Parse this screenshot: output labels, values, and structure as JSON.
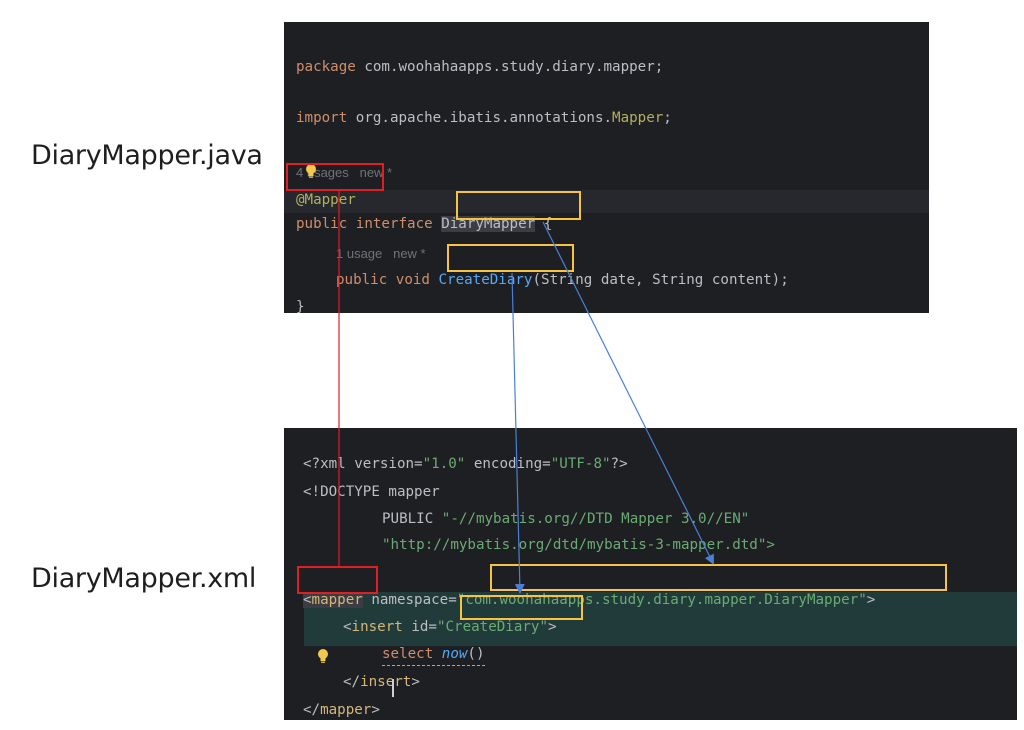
{
  "labels": {
    "java_file": "DiaryMapper.java",
    "xml_file": "DiaryMapper.xml"
  },
  "java_editor": {
    "line1": {
      "kw": "package",
      "rest": " com.woohahaapps.study.diary.mapper;"
    },
    "line2": {
      "kw": "import",
      "rest": " org.apache.ibatis.annotations.",
      "ann": "Mapper",
      "end": ";"
    },
    "usages_hint": "4 usages   new *",
    "line3": {
      "text": "@Mapper"
    },
    "line4": {
      "kw": "public interface",
      "name": "DiaryMapper",
      "end": " {"
    },
    "method_hint": "1 usage   new *",
    "line5": {
      "kw": "public void",
      "name": "CreateDiary",
      "params": "(String date, String content);"
    },
    "line6": "}"
  },
  "xml_editor": {
    "line1": {
      "a": "<?",
      "b": "xml version=",
      "c": "\"1.0\"",
      "d": " encoding=",
      "e": "\"UTF-8\"",
      "f": "?>"
    },
    "line2": {
      "a": "<!DOCTYPE ",
      "b": "mapper"
    },
    "line3": {
      "a": "PUBLIC ",
      "b": "\"-//mybatis.org//DTD Mapper 3.0//EN\""
    },
    "line4": "\"http://mybatis.org/dtd/mybatis-3-mapper.dtd\">",
    "line5": {
      "open": "<",
      "tag": "mapper",
      "attr": " namespace=",
      "q1": "\"",
      "value": "com.woohahaapps.study.diary.mapper.DiaryMapper",
      "q2": "\"",
      "close": ">"
    },
    "line6": {
      "open": "<",
      "tag": "insert",
      "attr": " id=",
      "q1": "\"",
      "value": "CreateDiary",
      "q2": "\"",
      "close": ">"
    },
    "line7": {
      "a": "select ",
      "b": "now",
      "c": "()"
    },
    "line8": {
      "open": "</",
      "tag": "insert",
      "close": ">"
    },
    "line9": {
      "open": "</",
      "tag": "mapper",
      "close": ">"
    }
  },
  "colors": {
    "editor_bg": "#1e1f22",
    "keyword": "#cf8e6d",
    "annotation": "#b3ae60",
    "function": "#56a8f5",
    "string": "#6aab73",
    "tag": "#d5b778",
    "red_box": "#e01f24",
    "yellow_box": "#f6c343",
    "blue_arrow": "#4a7fd8"
  }
}
